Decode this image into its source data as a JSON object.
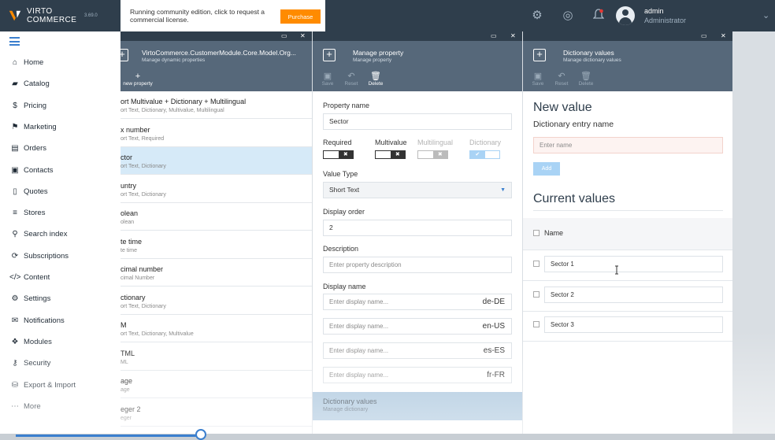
{
  "header": {
    "brand_line1": "VIRTO",
    "brand_line2": "COMMERCE",
    "version": "3.69.0",
    "notice_text": "Running community edition, click to request a commercial license.",
    "purchase_label": "Purchase",
    "icons": [
      "gear-icon",
      "lifebuoy-icon",
      "bell-icon"
    ],
    "user_name": "admin",
    "user_role": "Administrator"
  },
  "sidebar": {
    "items": [
      {
        "label": "Home",
        "icon": "home-icon",
        "glyph": "⌂"
      },
      {
        "label": "Catalog",
        "icon": "folder-icon",
        "glyph": "▰"
      },
      {
        "label": "Pricing",
        "icon": "dollar-icon",
        "glyph": "$"
      },
      {
        "label": "Marketing",
        "icon": "flag-icon",
        "glyph": "⚑"
      },
      {
        "label": "Orders",
        "icon": "document-icon",
        "glyph": "▤"
      },
      {
        "label": "Contacts",
        "icon": "id-card-icon",
        "glyph": "▣"
      },
      {
        "label": "Quotes",
        "icon": "file-icon",
        "glyph": "▯"
      },
      {
        "label": "Stores",
        "icon": "storage-icon",
        "glyph": "≡"
      },
      {
        "label": "Search index",
        "icon": "search-icon",
        "glyph": "⚲"
      },
      {
        "label": "Subscriptions",
        "icon": "refresh-icon",
        "glyph": "⟳"
      },
      {
        "label": "Content",
        "icon": "code-icon",
        "glyph": "</>"
      },
      {
        "label": "Settings",
        "icon": "cogs-icon",
        "glyph": "⚙"
      },
      {
        "label": "Notifications",
        "icon": "envelope-icon",
        "glyph": "✉"
      },
      {
        "label": "Modules",
        "icon": "cubes-icon",
        "glyph": "❖"
      },
      {
        "label": "Security",
        "icon": "key-icon",
        "glyph": "⚷"
      },
      {
        "label": "Export & Import",
        "icon": "database-icon",
        "glyph": "⛁"
      },
      {
        "label": "More",
        "icon": "ellipsis-icon",
        "glyph": "⋯"
      }
    ]
  },
  "blade1": {
    "title": "VirtoCommerce.CustomerModule.Core.Model.Org...",
    "subtitle": "Manage dynamic properties",
    "toolbar_new": "new property",
    "rows": [
      {
        "title": "ort Multivalue + Dictionary + Multilingual",
        "sub": "ort Text, Dictionary, Multivalue, Multilingual",
        "selected": false
      },
      {
        "title": "x number",
        "sub": "ort Text, Required",
        "selected": false
      },
      {
        "title": "ctor",
        "sub": "ort Text, Dictionary",
        "selected": true
      },
      {
        "title": "untry",
        "sub": "ort Text, Dictionary",
        "selected": false
      },
      {
        "title": "olean",
        "sub": "olean",
        "selected": false
      },
      {
        "title": "te time",
        "sub": "te time",
        "selected": false
      },
      {
        "title": "cimal number",
        "sub": "cimal Number",
        "selected": false
      },
      {
        "title": "ctionary",
        "sub": "ort Text, Dictionary",
        "selected": false
      },
      {
        "title": "M",
        "sub": "ort Text, Dictionary, Multivalue",
        "selected": false
      },
      {
        "title": "TML",
        "sub": "ML",
        "selected": false
      },
      {
        "title": "age",
        "sub": "age",
        "selected": false
      },
      {
        "title": "eger 2",
        "sub": "eger",
        "selected": false
      }
    ]
  },
  "blade2": {
    "title": "Manage property",
    "subtitle": "Manage property",
    "toolbar": {
      "save": "Save",
      "reset": "Reset",
      "delete": "Delete"
    },
    "property_name_label": "Property name",
    "property_name_value": "Sector",
    "flags": {
      "required": "Required",
      "multivalue": "Multivalue",
      "multilingual": "Multilingual",
      "dictionary": "Dictionary"
    },
    "value_type_label": "Value Type",
    "value_type_value": "Short Text",
    "display_order_label": "Display order",
    "display_order_value": "2",
    "description_label": "Description",
    "description_placeholder": "Enter property description",
    "display_name_label": "Display name",
    "display_names": [
      {
        "placeholder": "Enter display name...",
        "lang": "de-DE"
      },
      {
        "placeholder": "Enter display name...",
        "lang": "en-US"
      },
      {
        "placeholder": "Enter display name...",
        "lang": "es-ES"
      },
      {
        "placeholder": "Enter display name...",
        "lang": "fr-FR"
      }
    ],
    "dictionary_title": "Dictionary values",
    "dictionary_sub": "Manage dictionary"
  },
  "blade3": {
    "title": "Dictionary values",
    "subtitle": "Manage dictionary values",
    "toolbar": {
      "save": "Save",
      "reset": "Reset",
      "delete": "Delete"
    },
    "new_value_heading": "New value",
    "entry_label": "Dictionary entry name",
    "entry_placeholder": "Enter name",
    "add_label": "Add",
    "current_heading": "Current values",
    "name_header": "Name",
    "values": [
      "Sector 1",
      "Sector 2",
      "Sector 3"
    ]
  },
  "colors": {
    "topbar": "#2f3e4c",
    "blade_header": "#56687a",
    "accent": "#3b7fce",
    "purchase": "#ff8b00",
    "selected_row": "#d6eaf8"
  }
}
